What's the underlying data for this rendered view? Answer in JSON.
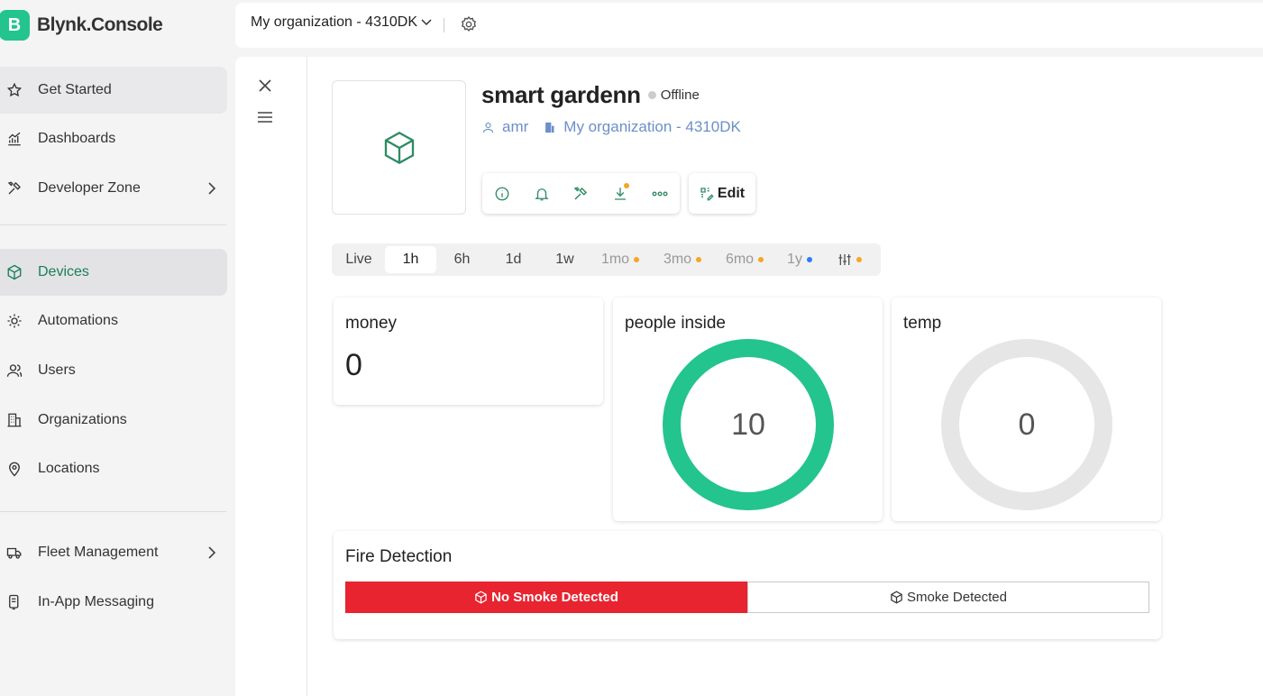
{
  "brand": {
    "logo_letter": "B",
    "name": "Blynk.Console",
    "color": "#23c48e"
  },
  "sidebar": {
    "items": [
      {
        "label": "Get Started",
        "icon": "star-icon"
      },
      {
        "label": "Dashboards",
        "icon": "chart-icon"
      },
      {
        "label": "Developer Zone",
        "icon": "tools-icon",
        "has_submenu": true
      },
      {
        "label": "Devices",
        "icon": "cube-icon",
        "active": true
      },
      {
        "label": "Automations",
        "icon": "automation-icon"
      },
      {
        "label": "Users",
        "icon": "users-icon"
      },
      {
        "label": "Organizations",
        "icon": "building-icon"
      },
      {
        "label": "Locations",
        "icon": "location-pin-icon"
      },
      {
        "label": "Fleet Management",
        "icon": "truck-icon",
        "has_submenu": true
      },
      {
        "label": "In-App Messaging",
        "icon": "message-icon"
      }
    ]
  },
  "topbar": {
    "org_label": "My organization - 4310DK"
  },
  "device": {
    "name": "smart gardenn",
    "status": "Offline",
    "owner": "amr",
    "organization": "My organization - 4310DK",
    "edit_label": "Edit",
    "actions": [
      "info-icon",
      "bell-icon",
      "tools-icon",
      "download-icon",
      "more-icon"
    ]
  },
  "time_range": {
    "options": [
      {
        "label": "Live"
      },
      {
        "label": "1h",
        "selected": true
      },
      {
        "label": "6h"
      },
      {
        "label": "1d"
      },
      {
        "label": "1w"
      },
      {
        "label": "1mo",
        "dot": "#f5a623"
      },
      {
        "label": "3mo",
        "dot": "#f5a623"
      },
      {
        "label": "6mo",
        "dot": "#f5a623"
      },
      {
        "label": "1y",
        "dot": "#2f7bf5"
      }
    ],
    "settings_dot": "#f5a623"
  },
  "widgets": {
    "money": {
      "title": "money",
      "value": "0"
    },
    "people": {
      "title": "people inside",
      "value": "10",
      "fill": 1.0,
      "color": "#23c48e"
    },
    "temp": {
      "title": "temp",
      "value": "0",
      "fill": 0.0,
      "color": "#e6e6e6"
    },
    "fire": {
      "title": "Fire Detection",
      "on_label": "No Smoke Detected",
      "off_label": "Smoke Detected",
      "on_color": "#e72430"
    }
  }
}
